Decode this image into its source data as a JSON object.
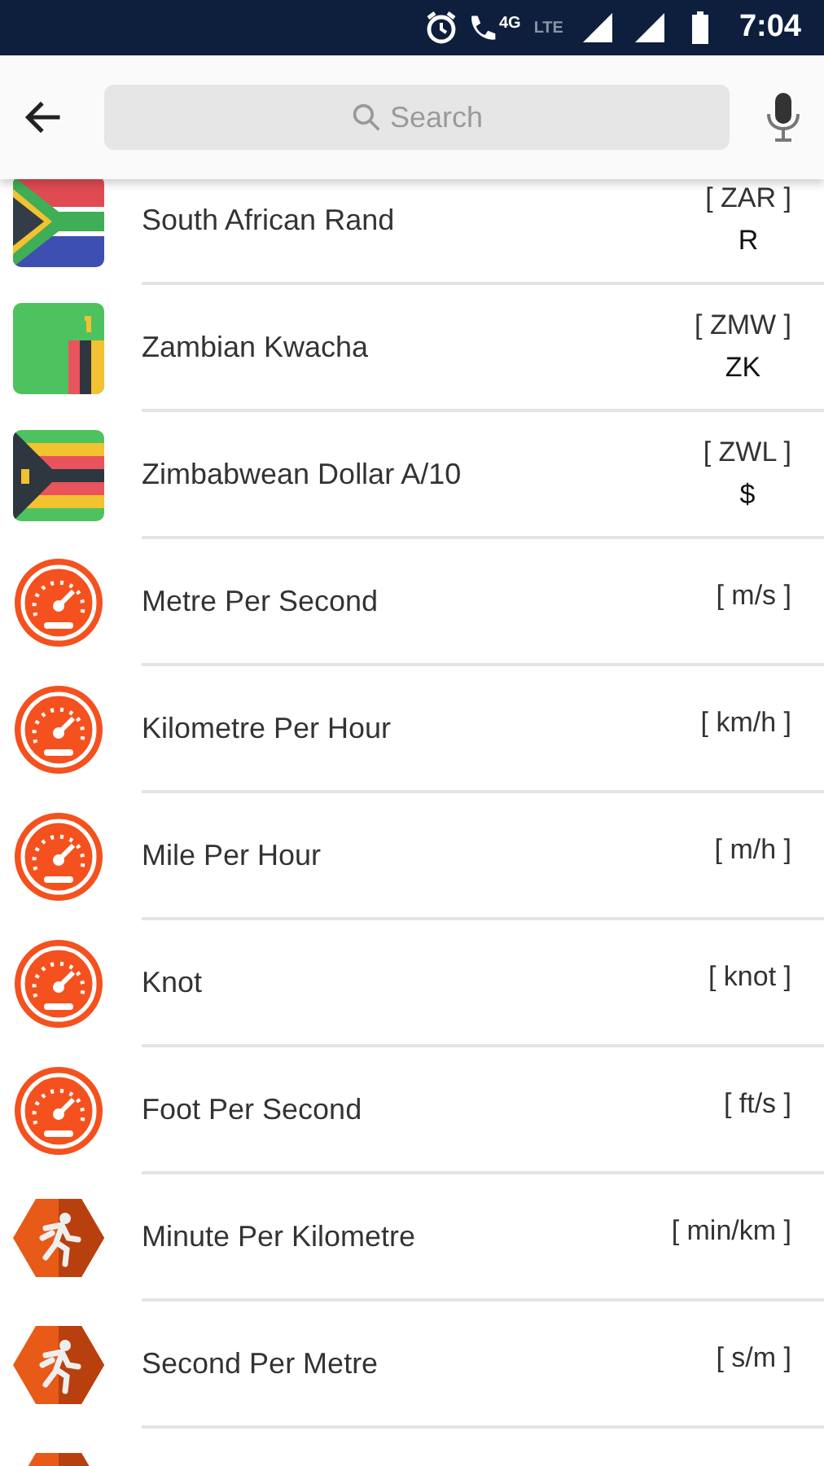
{
  "status_bar": {
    "network_labels": [
      "4G",
      "LTE"
    ],
    "time": "7:04"
  },
  "toolbar": {
    "search": {
      "placeholder": "Search"
    }
  },
  "units": [
    {
      "kind": "flag-za",
      "name": "South African Rand",
      "code": "[ ZAR ]",
      "symbol": "R"
    },
    {
      "kind": "flag-zm",
      "name": "Zambian Kwacha",
      "code": "[ ZMW ]",
      "symbol": "ZK"
    },
    {
      "kind": "flag-zw",
      "name": "Zimbabwean Dollar A/10",
      "code": "[ ZWL ]",
      "symbol": "$"
    },
    {
      "kind": "speed",
      "name": "Metre Per Second",
      "code": "[ m/s ]"
    },
    {
      "kind": "speed",
      "name": "Kilometre Per Hour",
      "code": "[ km/h ]"
    },
    {
      "kind": "speed",
      "name": "Mile Per Hour",
      "code": "[ m/h ]"
    },
    {
      "kind": "speed",
      "name": "Knot",
      "code": "[ knot ]"
    },
    {
      "kind": "speed",
      "name": "Foot Per Second",
      "code": "[ ft/s ]"
    },
    {
      "kind": "pace",
      "name": "Minute Per Kilometre",
      "code": "[ min/km ]"
    },
    {
      "kind": "pace",
      "name": "Second Per Metre",
      "code": "[ s/m ]"
    },
    {
      "kind": "pace"
    }
  ]
}
